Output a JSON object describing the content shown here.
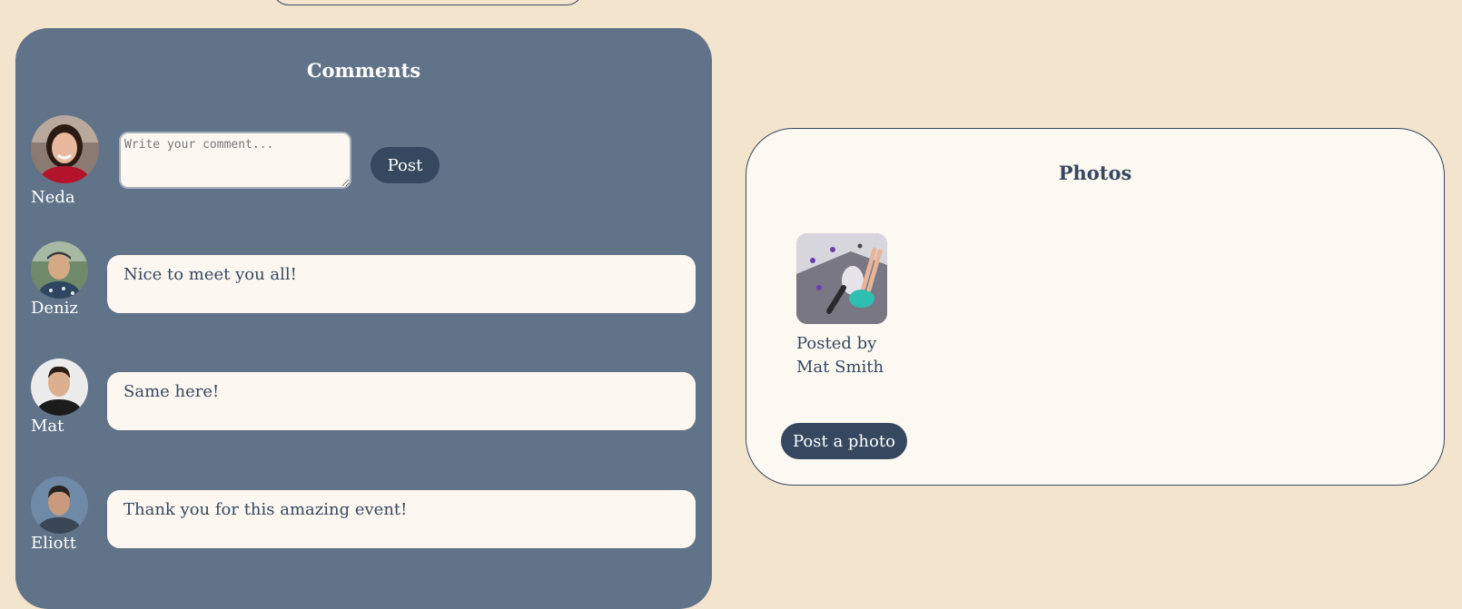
{
  "comments": {
    "title": "Comments",
    "composer": {
      "user_name": "Neda",
      "placeholder": "Write your comment...",
      "post_label": "Post"
    },
    "items": [
      {
        "user_name": "Deniz",
        "text": "Nice to meet you all!"
      },
      {
        "user_name": "Mat",
        "text": "Same here!"
      },
      {
        "user_name": "Eliott",
        "text": "Thank you for this amazing event!"
      }
    ]
  },
  "photos": {
    "title": "Photos",
    "items": [
      {
        "caption": "Posted by Mat Smith",
        "icon": "climbing-photo"
      }
    ],
    "post_photo_label": "Post a photo"
  },
  "colors": {
    "page_background": "#f3e4cd",
    "comments_panel": "#617389",
    "accent_dark": "#36485f",
    "card_background": "#fcf7f1"
  }
}
